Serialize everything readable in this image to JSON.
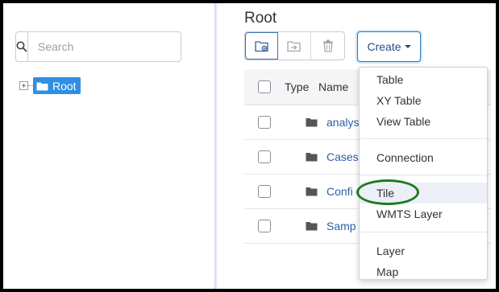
{
  "search": {
    "placeholder": "Search"
  },
  "tree": {
    "root_label": "Root"
  },
  "main": {
    "title": "Root",
    "create_label": "Create"
  },
  "table": {
    "headers": {
      "type": "Type",
      "name": "Name"
    },
    "rows": [
      {
        "name": "analys"
      },
      {
        "name": "Cases"
      },
      {
        "name": "Confi"
      },
      {
        "name": "Samp"
      }
    ]
  },
  "menu": {
    "items": [
      "Table",
      "XY Table",
      "View Table",
      "Connection",
      "Tile",
      "WMTS Layer",
      "Layer",
      "Map"
    ],
    "highlighted": "Tile"
  },
  "colors": {
    "accent": "#2f8fe3",
    "create_border": "#1f7fc4",
    "highlight_circle": "#1f7a1f",
    "link": "#2f5fa9"
  },
  "icons": [
    "search-icon",
    "expand-icon",
    "folder-icon",
    "new-folder-icon",
    "move-icon",
    "trash-icon",
    "caret-down-icon"
  ]
}
